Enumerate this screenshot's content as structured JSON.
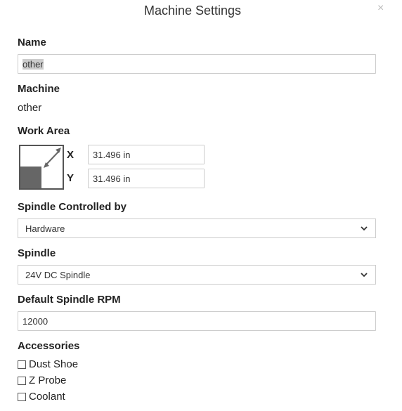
{
  "dialog": {
    "title": "Machine Settings",
    "close_glyph": "×"
  },
  "name": {
    "label": "Name",
    "value": "other"
  },
  "machine": {
    "label": "Machine",
    "value": "other"
  },
  "work_area": {
    "label": "Work Area",
    "x_label": "X",
    "x_value": "31.496 in",
    "y_label": "Y",
    "y_value": "31.496 in"
  },
  "spindle_control": {
    "label": "Spindle Controlled by",
    "selected": "Hardware"
  },
  "spindle": {
    "label": "Spindle",
    "selected": "24V DC Spindle"
  },
  "rpm": {
    "label": "Default Spindle RPM",
    "value": "12000"
  },
  "accessories": {
    "label": "Accessories",
    "items": [
      {
        "label": "Dust Shoe",
        "checked": false
      },
      {
        "label": "Z Probe",
        "checked": false
      },
      {
        "label": "Coolant",
        "checked": false
      }
    ]
  },
  "icons": {
    "close": "close-icon",
    "dropdown": "chevron-down-icon",
    "work_area": "work-area-icon"
  }
}
